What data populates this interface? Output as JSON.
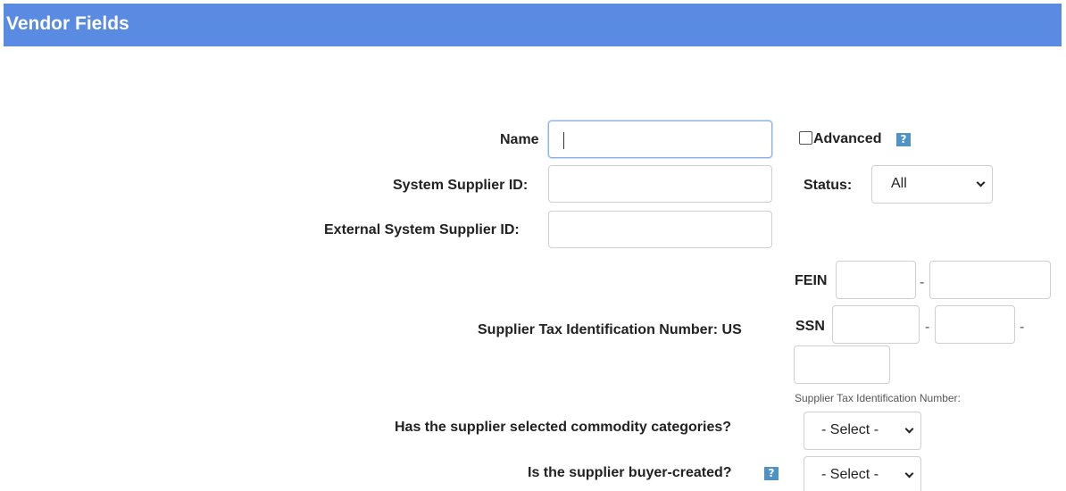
{
  "header": {
    "title": "Vendor Fields"
  },
  "form": {
    "name_label": "Name",
    "name_value": "",
    "advanced_label": "Advanced",
    "system_supplier_id_label": "System Supplier ID:",
    "status_label": "Status:",
    "status_value": "All",
    "external_system_supplier_id_label": "External System Supplier ID:",
    "tax_id_label": "Supplier Tax Identification Number: US",
    "fein_label": "FEIN",
    "ssn_label": "SSN",
    "dash": "-",
    "tax_id_hint": "Supplier Tax Identification Number:",
    "commodity_label": "Has the supplier selected commodity categories?",
    "commodity_value": "- Select -",
    "buyer_created_label": "Is the supplier buyer-created?",
    "buyer_created_value": "- Select -",
    "help_glyph": "?"
  },
  "icons": {
    "help": "help-icon",
    "dropdown": "chevron-down-icon",
    "checkbox": "checkbox"
  },
  "colors": {
    "header_bg": "#5a8be3",
    "header_text": "#ffffff",
    "help_icon_bg": "#4f93c4",
    "focus_border": "#8db2e8"
  }
}
